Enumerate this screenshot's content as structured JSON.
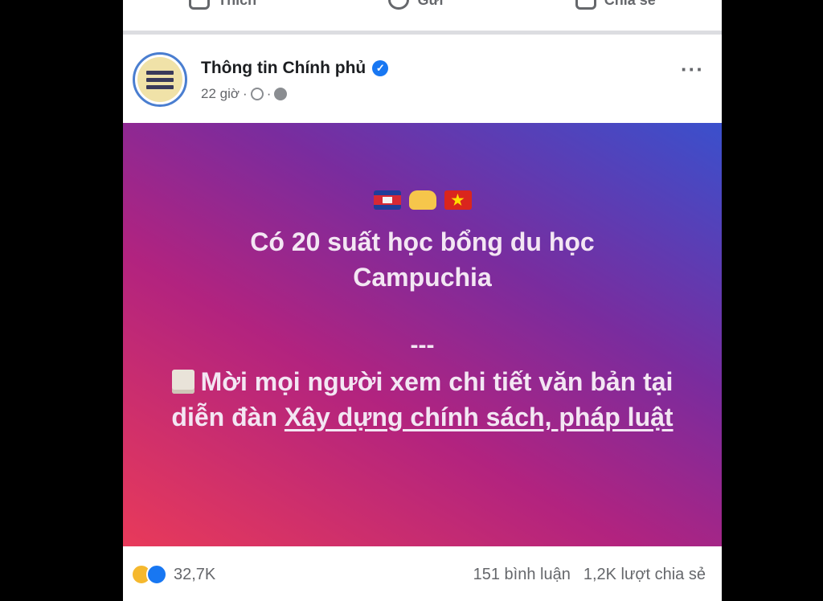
{
  "action_bar": {
    "like_label": "Thích",
    "comment_label": "Gửi",
    "share_label": "Chia sẻ"
  },
  "post": {
    "page_name": "Thông tin Chính phủ",
    "time": "22 giờ",
    "meta_sep1": "·",
    "meta_sep2": "·",
    "more": "···",
    "body": {
      "headline_line1": "Có 20 suất học bổng du học",
      "headline_line2": "Campuchia",
      "dashes": "---",
      "text_prefix": "Mời mọi người xem chi tiết văn bản tại diễn đàn ",
      "link_text": "Xây dựng chính sách, pháp luật"
    },
    "stats": {
      "reaction_count": "32,7K",
      "comments": "151 bình luận",
      "shares": "1,2K lượt chia sẻ"
    }
  },
  "icons": [
    "like-icon",
    "messenger-icon",
    "share-icon",
    "verified-icon",
    "clock-icon",
    "globe-icon",
    "cambodia-flag-icon",
    "handshake-icon",
    "vietnam-flag-icon",
    "document-icon",
    "haha-reaction-icon",
    "like-reaction-icon"
  ],
  "colors": {
    "verified": "#1877f2",
    "gradient_start": "#e83a5a",
    "gradient_end": "#3a50cc"
  }
}
